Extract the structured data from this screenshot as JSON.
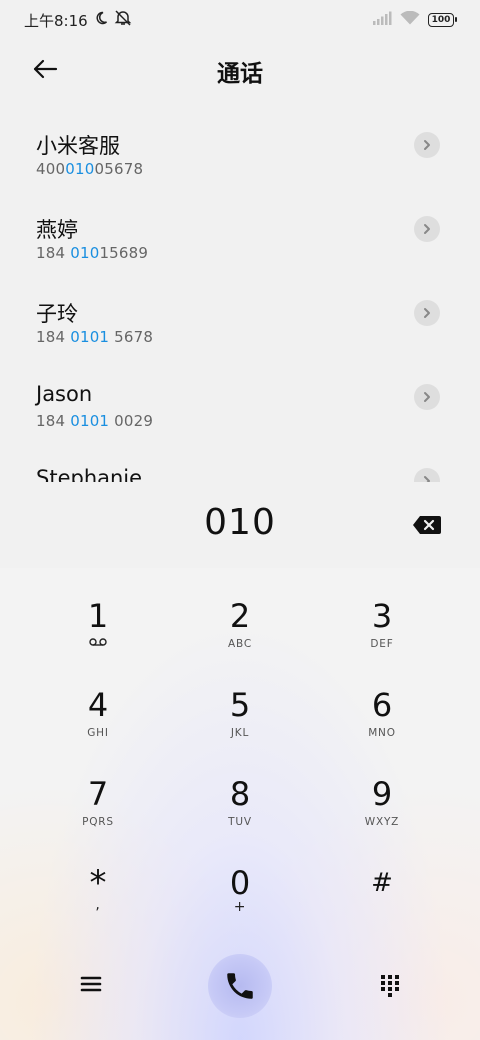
{
  "status": {
    "time": "上午8:16",
    "battery": "100"
  },
  "header": {
    "title": "通话"
  },
  "contacts": [
    {
      "name": "小米客服",
      "num_pre": "400",
      "num_match": "010",
      "num_post": "05678"
    },
    {
      "name": "燕婷",
      "num_pre": "184 ",
      "num_match": "010",
      "num_post": "15689"
    },
    {
      "name": "子玲",
      "num_pre": "184 ",
      "num_match": "0101",
      "num_post": " 5678"
    },
    {
      "name": "Jason",
      "num_pre": "184 ",
      "num_match": "0101",
      "num_post": " 0029"
    },
    {
      "name": "Stephanie",
      "num_pre": "",
      "num_match": "",
      "num_post": ""
    }
  ],
  "dialer": {
    "number": "010"
  },
  "keys": [
    {
      "digit": "1",
      "letters": ""
    },
    {
      "digit": "2",
      "letters": "ABC"
    },
    {
      "digit": "3",
      "letters": "DEF"
    },
    {
      "digit": "4",
      "letters": "GHI"
    },
    {
      "digit": "5",
      "letters": "JKL"
    },
    {
      "digit": "6",
      "letters": "MNO"
    },
    {
      "digit": "7",
      "letters": "PQRS"
    },
    {
      "digit": "8",
      "letters": "TUV"
    },
    {
      "digit": "9",
      "letters": "WXYZ"
    },
    {
      "digit": "*",
      "letters": ","
    },
    {
      "digit": "0",
      "letters": "+"
    },
    {
      "digit": "#",
      "letters": ""
    }
  ],
  "colors": {
    "match": "#1a8fe0",
    "call_button": "#c6c9f6"
  }
}
